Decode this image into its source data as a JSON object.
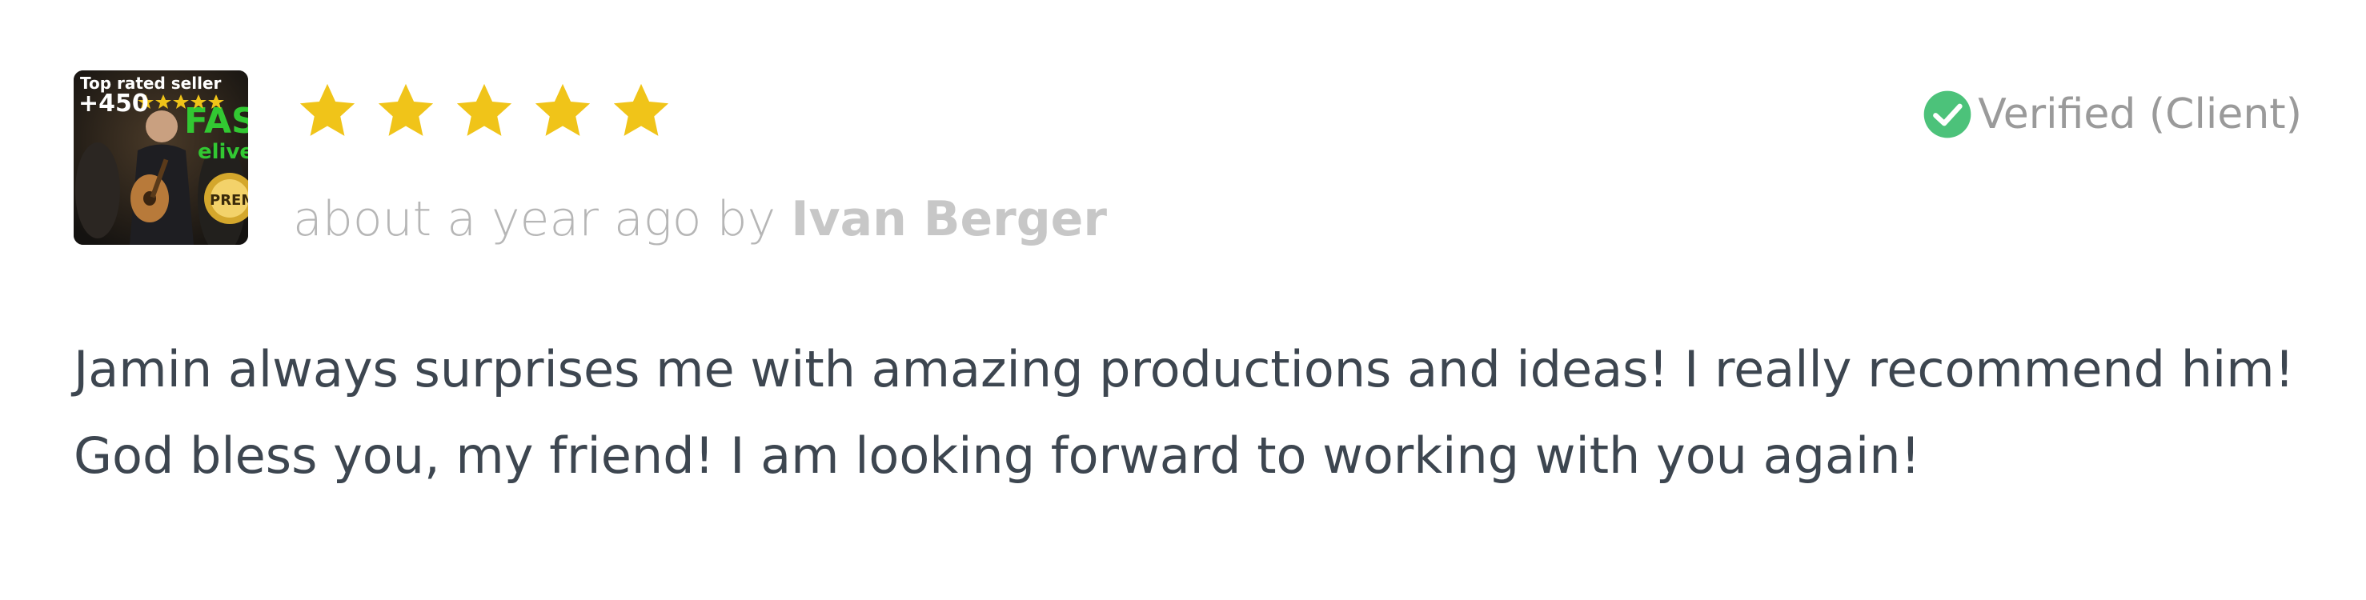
{
  "thumbnail": {
    "top_text": "Top rated seller",
    "count_text": "+450"
  },
  "rating": {
    "stars": 5,
    "max": 5,
    "star_color": "#f0c419"
  },
  "meta": {
    "time": "about a year ago by ",
    "author": "Ivan Berger"
  },
  "verified": {
    "label": "Verified (Client)",
    "icon": "check-circle-icon",
    "color": "#4cc27a"
  },
  "review": {
    "line1": "Jamin always surprises me with amazing productions and ideas! I really recommend him!",
    "line2": "God bless you, my friend! I am looking forward to working with you again!"
  }
}
